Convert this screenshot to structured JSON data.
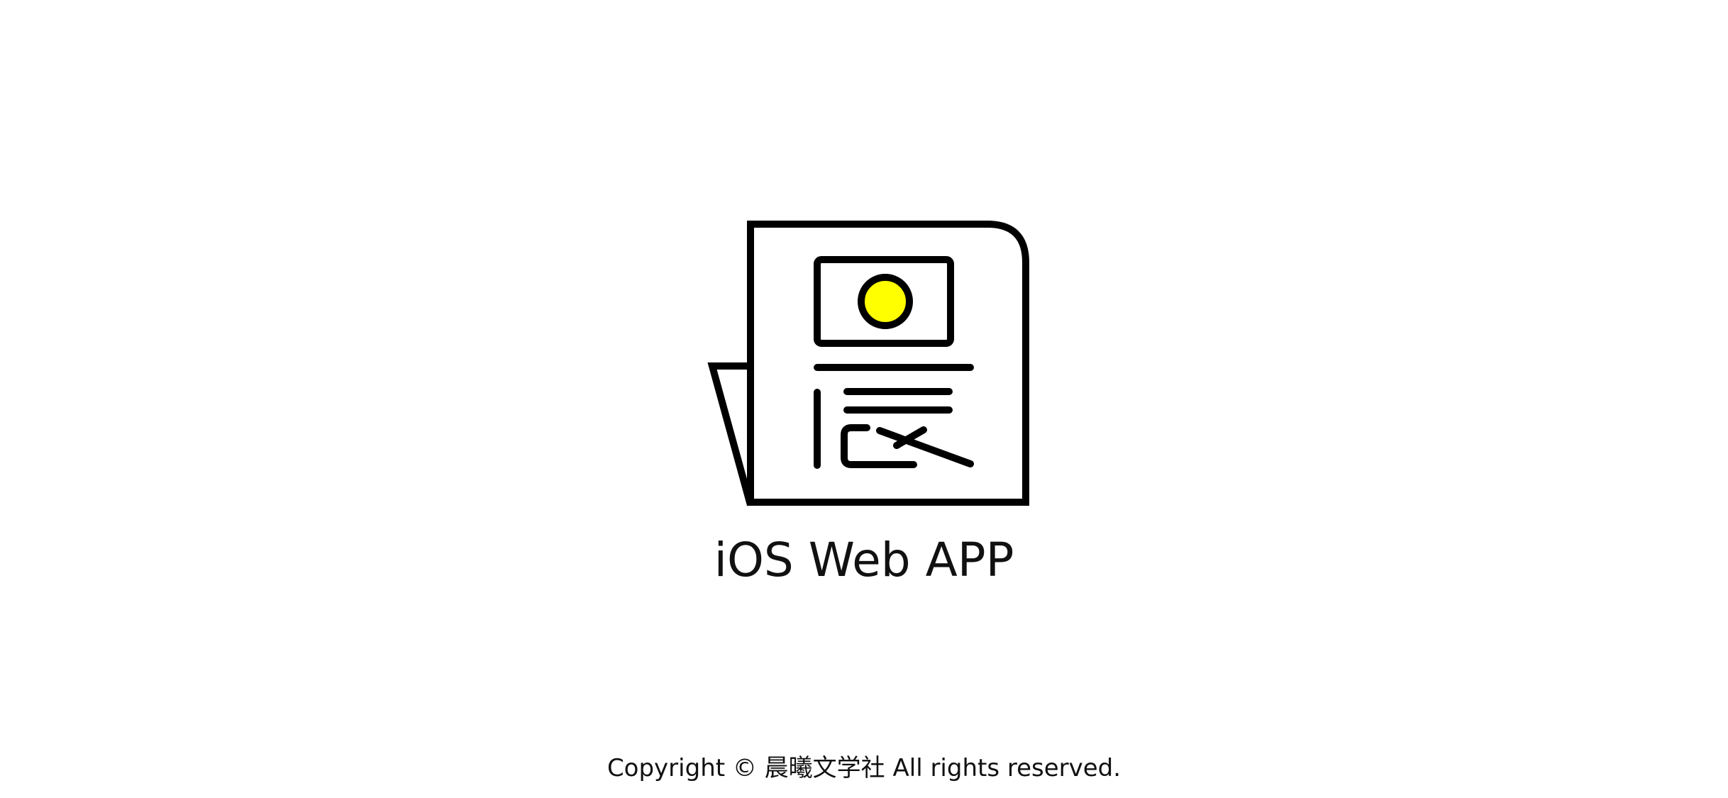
{
  "splash": {
    "logo_icon": "newspaper-chen-logo-icon",
    "title": "iOS Web APP",
    "copyright": "Copyright © 晨曦文学社 All rights reserved."
  },
  "colors": {
    "background": "#ffffff",
    "ink": "#000000",
    "sun": "#ffff00"
  }
}
